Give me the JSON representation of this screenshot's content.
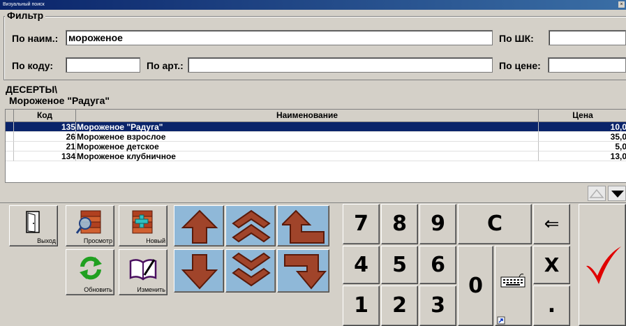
{
  "window": {
    "title": "Визуальный поиск"
  },
  "filter": {
    "legend": "Фильтр",
    "name_label": "По наим.:",
    "name_value": "мороженое",
    "barcode_label": "По ШК:",
    "barcode_value": "",
    "code_label": "По коду:",
    "code_value": "",
    "article_label": "По арт.:",
    "article_value": "",
    "price_label": "По цене:",
    "price_value": ""
  },
  "breadcrumb": {
    "group": "ДЕСЕРТЫ\\",
    "item": "Мороженое \"Радуга\""
  },
  "table": {
    "headers": {
      "code": "Код",
      "name": "Наименование",
      "price": "Цена"
    },
    "rows": [
      {
        "code": "135",
        "name": "Мороженое \"Радуга\"",
        "price": "10,0",
        "selected": true
      },
      {
        "code": "26",
        "name": "Мороженое взрослое",
        "price": "35,0",
        "selected": false
      },
      {
        "code": "21",
        "name": "Мороженое детское",
        "price": "5,0",
        "selected": false
      },
      {
        "code": "134",
        "name": "Мороженое клубничное",
        "price": "13,0",
        "selected": false
      }
    ]
  },
  "actions": {
    "exit": "Выход",
    "view": "Просмотр",
    "new": "Новый",
    "refresh": "Обновить",
    "edit": "Изменить"
  },
  "keypad": {
    "k7": "7",
    "k8": "8",
    "k9": "9",
    "clear": "C",
    "backspace": "⇐",
    "k4": "4",
    "k5": "5",
    "k6": "6",
    "k0": "0",
    "multiply": "X",
    "k1": "1",
    "k2": "2",
    "k3": "3",
    "dot": "."
  },
  "colors": {
    "selection": "#0a246a",
    "arrow": "#a0442a",
    "check": "#e00000"
  }
}
